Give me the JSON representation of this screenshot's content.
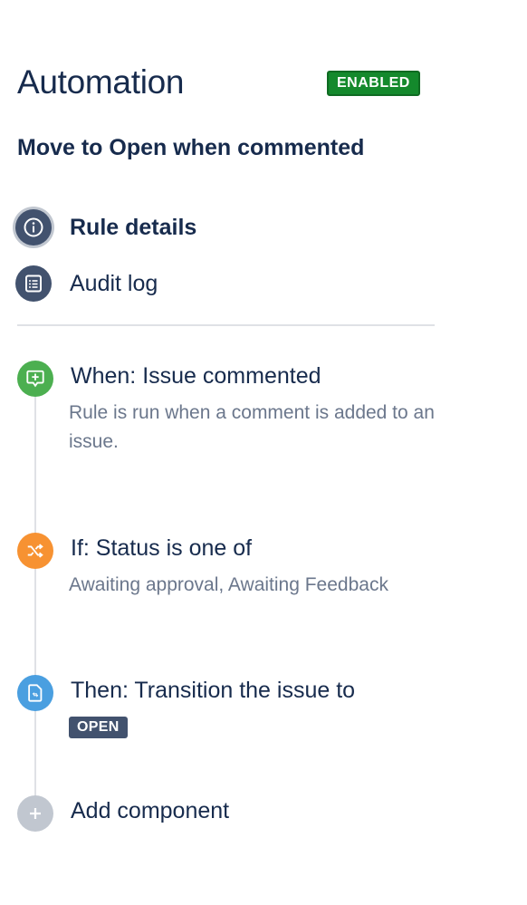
{
  "header": {
    "title": "Automation",
    "status_badge": "ENABLED"
  },
  "rule": {
    "name": "Move to Open when commented"
  },
  "nav": {
    "items": [
      {
        "label": "Rule details",
        "icon": "info-icon",
        "active": true
      },
      {
        "label": "Audit log",
        "icon": "list-icon",
        "active": false
      }
    ]
  },
  "components": [
    {
      "title": "When: Issue commented",
      "description": "Rule is run when a comment is added to an issue.",
      "icon": "comment-add-icon",
      "color": "#4caf50"
    },
    {
      "title": "If: Status is one of",
      "description": "Awaiting approval, Awaiting Feedback",
      "icon": "shuffle-icon",
      "color": "#f79232"
    },
    {
      "title": "Then: Transition the issue to",
      "status": "OPEN",
      "icon": "transition-doc-icon",
      "color": "#4a9fe0"
    },
    {
      "title": "Add component",
      "icon": "plus-icon",
      "color": "#c1c7d0"
    }
  ],
  "colors": {
    "enabled_green": "#14892c",
    "nav_icon": "#42526e",
    "text_primary": "#172b4d",
    "text_secondary": "#6b778c"
  }
}
